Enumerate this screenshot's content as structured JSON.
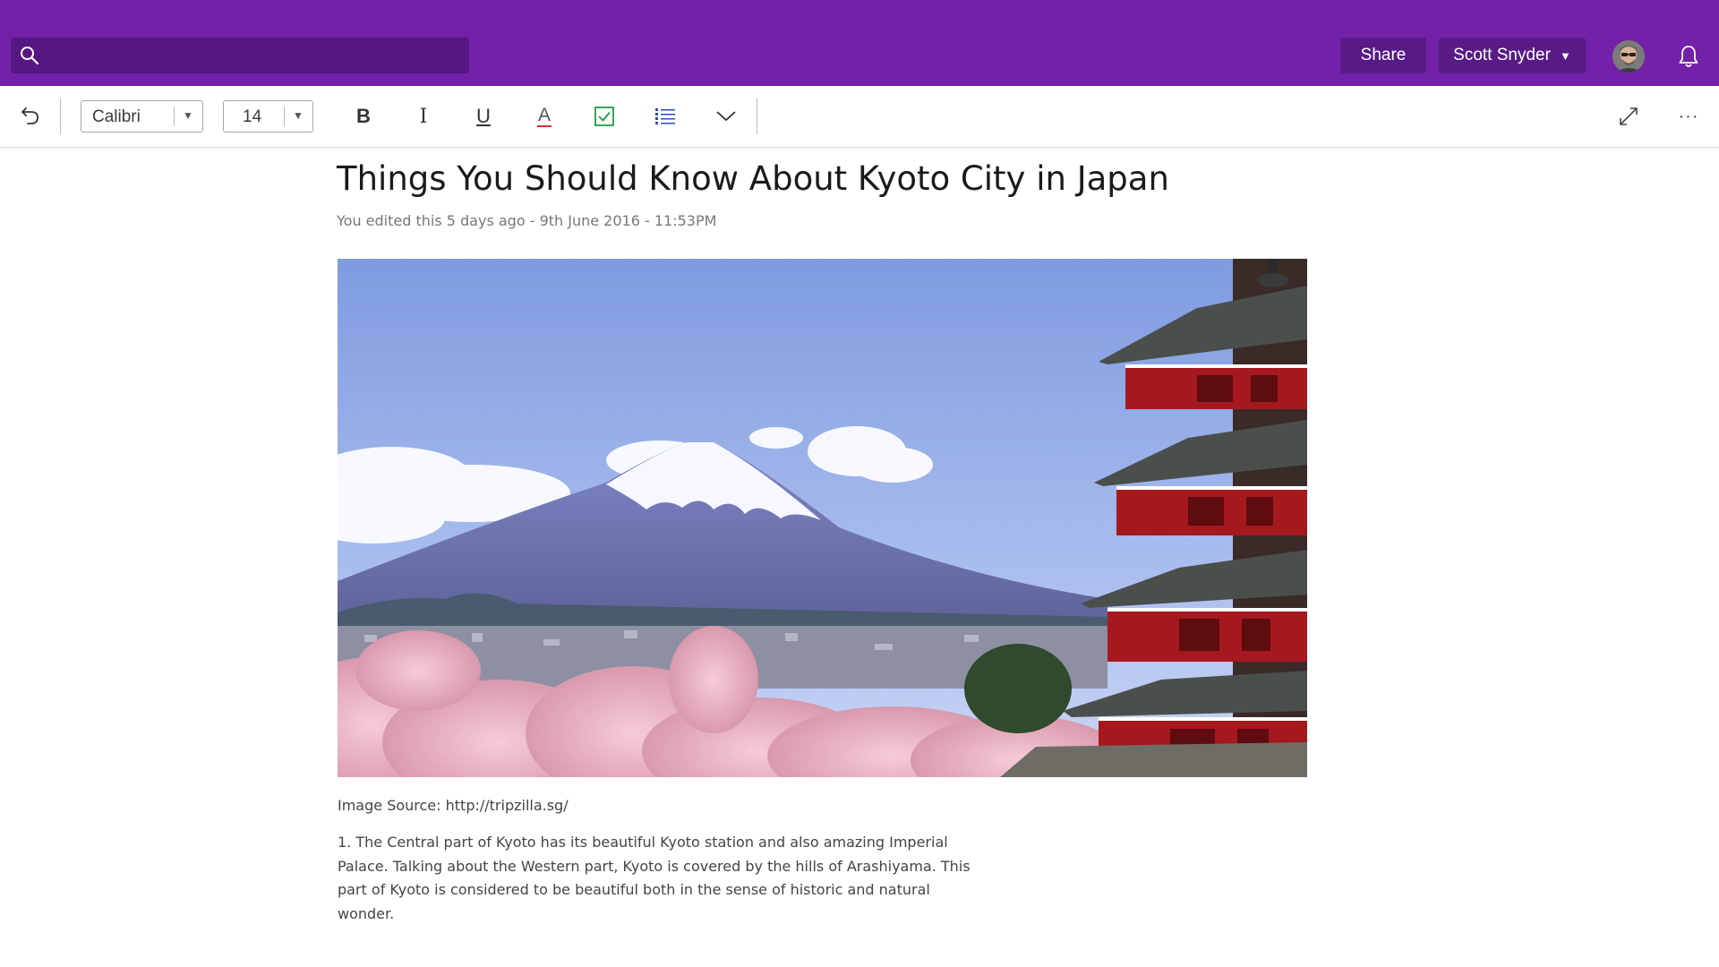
{
  "colors": {
    "accent": "#7321a8",
    "accent_dark": "#561782",
    "toolbar_bg": "#ffffff",
    "checkbox_green": "#1e9b4b",
    "list_blue": "#2e4db3",
    "font_color_red": "#d13438"
  },
  "header": {
    "search": {
      "value": "",
      "placeholder": "",
      "icon": "search-icon"
    },
    "share_label": "Share",
    "user_name": "Scott Snyder",
    "user_caret": "▼",
    "avatar_icon": "avatar",
    "notifications_icon": "bell-icon"
  },
  "toolbar": {
    "undo_icon": "undo-icon",
    "font_family": "Calibri",
    "font_size": "14",
    "dropdown_arrow": "▼",
    "bold_label": "B",
    "italic_label": "I",
    "underline_label": "U",
    "font_color_label": "A",
    "tag_icon": "checkbox-icon",
    "list_icon": "list-icon",
    "more_icon": "chevron-down-icon",
    "expand_icon": "expand-icon",
    "overflow_icon": "more-icon",
    "overflow_label": "···"
  },
  "page": {
    "title": "Things You Should Know About Kyoto City in Japan",
    "meta": "You edited this 5 days ago - 9th June 2016 - 11:53PM",
    "image_caption": "Image Source: http://tripzilla.sg/",
    "paragraph": "1. The Central part of Kyoto has its beautiful Kyoto station and also amazing Imperial Palace. Talking about the Western part, Kyoto is covered by the hills of Arashiyama. This part of Kyoto is considered to be beautiful both in the sense of historic and natural wonder."
  }
}
